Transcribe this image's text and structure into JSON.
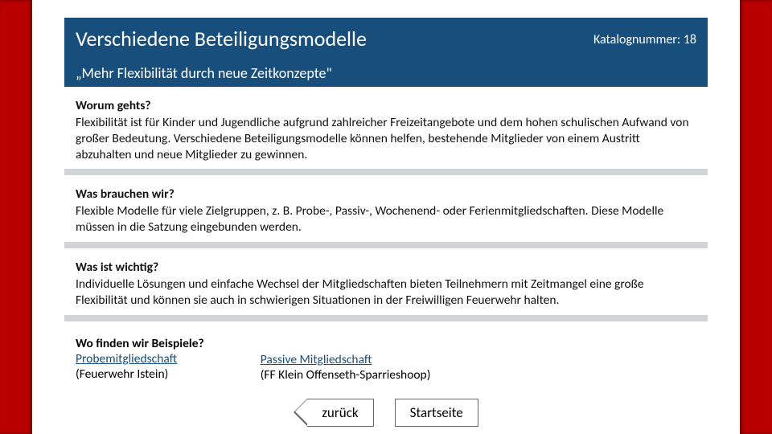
{
  "hero": {
    "title": "Verschiedene Beteiligungsmodelle",
    "catalog_label": "Katalognummer: 18",
    "subtitle": "„Mehr Flexibilität durch neue Zeitkonzepte\""
  },
  "sections": {
    "about": {
      "heading": "Worum gehts?",
      "body": "Flexibilität ist für Kinder und Jugendliche aufgrund zahlreicher Freizeitangebote und dem hohen schulischen Aufwand von großer Bedeutung. Verschiedene Beteiligungsmodelle können helfen, bestehende Mitglieder von einem Austritt abzuhalten und neue Mitglieder zu gewinnen."
    },
    "need": {
      "heading": "Was brauchen wir?",
      "body": "Flexible Modelle für viele Zielgruppen, z. B. Probe-, Passiv-, Wochenend- oder Ferienmitgliedschaften. Diese Modelle müssen in die Satzung eingebunden werden."
    },
    "important": {
      "heading": "Was ist wichtig?",
      "body": "Individuelle Lösungen und einfache Wechsel der Mitgliedschaften bieten Teilnehmern mit Zeitmangel eine große Flexibilität und können sie auch in schwierigen Situationen in der Freiwilligen Feuerwehr halten."
    }
  },
  "examples": {
    "heading": "Wo finden wir Beispiele?",
    "col1": {
      "link": "Probemitgliedschaft",
      "sub": "(Feuerwehr Istein)"
    },
    "col2": {
      "link": "Passive Mitgliedschaft",
      "sub": "(FF Klein Offenseth-Sparrieshoop)"
    }
  },
  "nav": {
    "back": "zurück",
    "home": "Startseite"
  }
}
